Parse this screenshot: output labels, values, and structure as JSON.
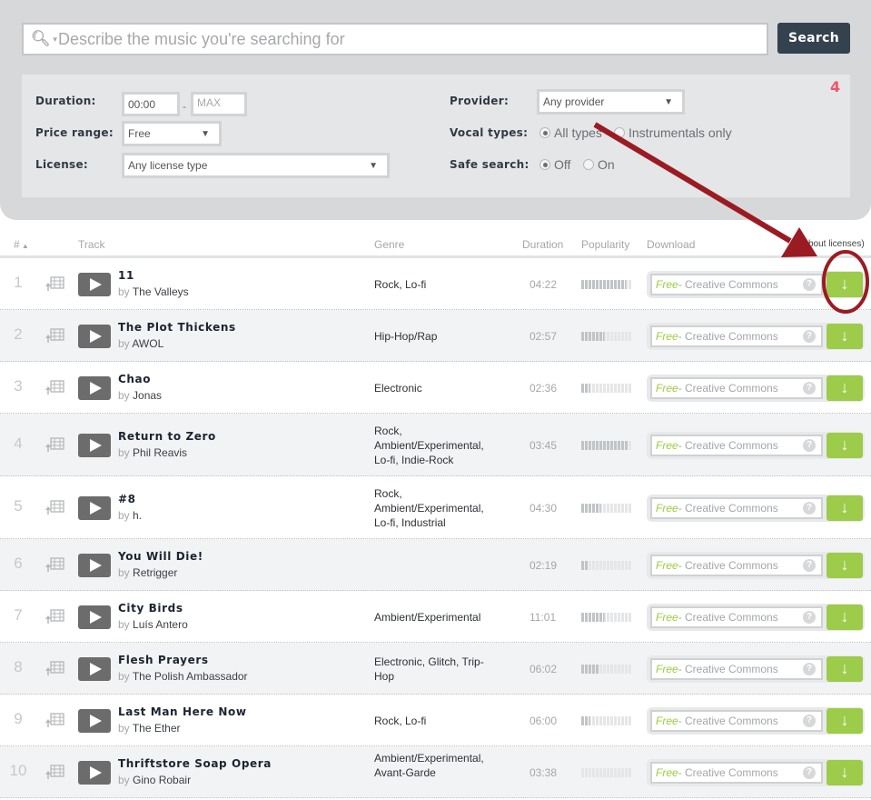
{
  "search": {
    "placeholder": "Describe the music you're searching for",
    "button_label": "Search"
  },
  "filters": {
    "duration_label": "Duration:",
    "duration_min": "00:00",
    "duration_max_placeholder": "MAX",
    "duration_separator": "-",
    "price_label": "Price range:",
    "price_value": "Free",
    "license_label": "License:",
    "license_value": "Any license type",
    "provider_label": "Provider:",
    "provider_value": "Any provider",
    "vocal_label": "Vocal types:",
    "vocal_options": [
      {
        "label": "All types",
        "selected": true
      },
      {
        "label": "Instrumentals only",
        "selected": false
      }
    ],
    "safe_label": "Safe search:",
    "safe_options": [
      {
        "label": "Off",
        "selected": true
      },
      {
        "label": "On",
        "selected": false
      }
    ],
    "corner_mark": "4"
  },
  "table": {
    "headers": {
      "num": "#",
      "track": "Track",
      "genre": "Genre",
      "duration": "Duration",
      "popularity": "Popularity",
      "download": "Download",
      "about": "(About licenses)"
    },
    "popularity_max": 14,
    "rows": [
      {
        "num": "1",
        "title": "11",
        "by": "by",
        "artist": "The Valleys",
        "genre": "Rock, Lo-fi",
        "duration": "04:22",
        "popularity": 12.5,
        "license_free": "Free",
        "license_rest": " - Creative Commons"
      },
      {
        "num": "2",
        "title": "The Plot Thickens",
        "by": "by",
        "artist": "AWOL",
        "genre": "Hip-Hop/Rap",
        "duration": "02:57",
        "popularity": 6.5,
        "license_free": "Free",
        "license_rest": " - Creative Commons"
      },
      {
        "num": "3",
        "title": "Chao",
        "by": "by",
        "artist": "Jonas",
        "genre": "Electronic",
        "duration": "02:36",
        "popularity": 2.5,
        "license_free": "Free",
        "license_rest": " - Creative Commons"
      },
      {
        "num": "4",
        "title": "Return to Zero",
        "by": "by",
        "artist": "Phil Reavis",
        "genre": "Rock, Ambient/Experimental, Lo-fi, Indie-Rock",
        "duration": "03:45",
        "popularity": 13,
        "license_free": "Free",
        "license_rest": " - Creative Commons"
      },
      {
        "num": "5",
        "title": "#8",
        "by": "by",
        "artist": "h.",
        "genre": "Rock, Ambient/Experimental, Lo-fi, Industrial",
        "duration": "04:30",
        "popularity": 5.5,
        "license_free": "Free",
        "license_rest": " - Creative Commons"
      },
      {
        "num": "6",
        "title": "You Will Die!",
        "by": "by",
        "artist": "Retrigger",
        "genre": "",
        "duration": "02:19",
        "popularity": 2,
        "license_free": "Free",
        "license_rest": " - Creative Commons"
      },
      {
        "num": "7",
        "title": "City Birds",
        "by": "by",
        "artist": "Luís Antero",
        "genre": "Ambient/Experimental",
        "duration": "11:01",
        "popularity": 6.5,
        "license_free": "Free",
        "license_rest": " - Creative Commons"
      },
      {
        "num": "8",
        "title": "Flesh Prayers",
        "by": "by",
        "artist": "The Polish Ambassador",
        "genre": "Electronic, Glitch, Trip-Hop",
        "duration": "06:02",
        "popularity": 5,
        "license_free": "Free",
        "license_rest": " - Creative Commons"
      },
      {
        "num": "9",
        "title": "Last Man Here Now",
        "by": "by",
        "artist": "The Ether",
        "genre": "Rock, Lo-fi",
        "duration": "06:00",
        "popularity": 2.5,
        "license_free": "Free",
        "license_rest": " - Creative Commons"
      },
      {
        "num": "10",
        "title": "Thriftstore Soap Opera",
        "by": "by",
        "artist": "Gino Robair",
        "genre": "Ambient/Experimental, Avant-Garde",
        "duration": "03:38",
        "popularity": 0,
        "license_free": "Free",
        "license_rest": " - Creative Commons"
      }
    ]
  },
  "colors": {
    "accent_green": "#9ccc49",
    "search_button": "#34414f",
    "annotation_red": "#9b1b22"
  }
}
